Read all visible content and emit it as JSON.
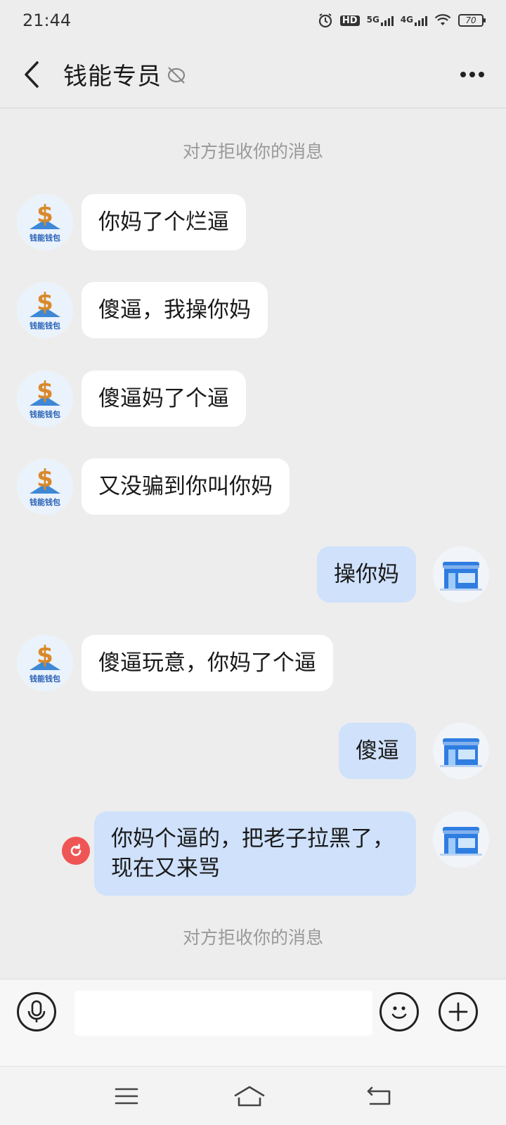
{
  "status_bar": {
    "time": "21:44",
    "hd_label": "HD",
    "net1": "5G",
    "net2": "4G",
    "battery": "70"
  },
  "header": {
    "title": "钱能专员"
  },
  "notices": {
    "top": "对方拒收你的消息",
    "bottom": "对方拒收你的消息"
  },
  "messages": [
    {
      "side": "left",
      "text": "你妈了个烂逼"
    },
    {
      "side": "left",
      "text": "傻逼，我操你妈"
    },
    {
      "side": "left",
      "text": "傻逼妈了个逼"
    },
    {
      "side": "left",
      "text": "又没骗到你叫你妈"
    },
    {
      "side": "right",
      "text": "操你妈"
    },
    {
      "side": "left",
      "text": "傻逼玩意，你妈了个逼"
    },
    {
      "side": "right",
      "text": "傻逼"
    },
    {
      "side": "right",
      "text": "你妈个逼的，把老子拉黑了，现在又来骂",
      "failed": true
    }
  ],
  "contact_avatar_text": "钱能钱包",
  "input": {
    "value": "",
    "placeholder": ""
  },
  "colors": {
    "background": "#ededed",
    "bubble_left": "#ffffff",
    "bubble_right": "#cfe1fb",
    "error": "#f05555"
  }
}
